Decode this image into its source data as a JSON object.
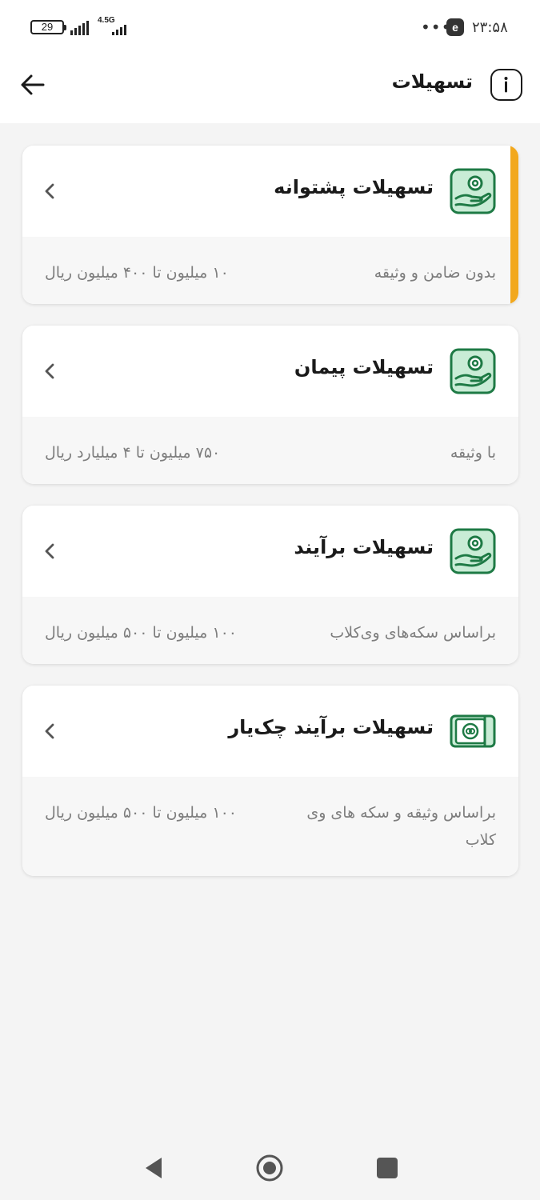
{
  "status_bar": {
    "battery": "29",
    "network": "4.5G",
    "dots": "•••",
    "app_icon_letter": "e",
    "time": "۲۳:۵۸"
  },
  "header": {
    "title": "تسهیلات"
  },
  "cards": [
    {
      "title": "تسهیلات پشتوانه",
      "subtitle": "بدون ضامن و وثیقه",
      "range": "۱۰ میلیون تا ۴۰۰ میلیون ریال",
      "icon": "hand-coin-icon",
      "active": true
    },
    {
      "title": "تسهیلات پیمان",
      "subtitle": "با وثیقه",
      "range": "۷۵۰ میلیون تا ۴ میلیارد ریال",
      "icon": "hand-coin-icon",
      "active": false
    },
    {
      "title": "تسهیلات برآیند",
      "subtitle": "براساس سکه‌های وی‌کلاب",
      "range": "۱۰۰ میلیون تا ۵۰۰ میلیون ریال",
      "icon": "hand-coin-icon",
      "active": false
    },
    {
      "title": "تسهیلات برآیند چک‌یار",
      "subtitle": "براساس وثیقه و سکه های وی کلاب",
      "range": "۱۰۰ میلیون تا ۵۰۰ میلیون ریال",
      "icon": "cheque-icon",
      "active": false
    }
  ],
  "colors": {
    "accent": "#f2a81d",
    "icon_green": "#1e7a45",
    "icon_fill": "#c9ecd6",
    "muted_text": "#7d7d7d"
  }
}
